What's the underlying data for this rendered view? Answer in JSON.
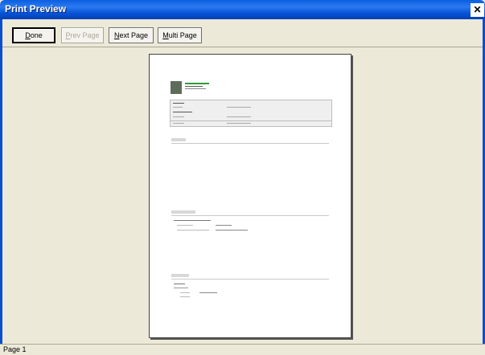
{
  "window": {
    "title": "Print Preview",
    "close_glyph": "✕"
  },
  "toolbar": {
    "done": {
      "pre": "",
      "u": "D",
      "post": "one"
    },
    "prev": {
      "pre": "",
      "u": "P",
      "post": "rev Page"
    },
    "next": {
      "pre": "",
      "u": "N",
      "post": "ext Page"
    },
    "multi": {
      "pre": "",
      "u": "M",
      "post": "ulti Page"
    }
  },
  "status": {
    "page": "Page 1"
  },
  "colors": {
    "title_bar": "#0A5FE0",
    "face": "#ECE9D8",
    "accent_text": "#2f9a3a"
  }
}
